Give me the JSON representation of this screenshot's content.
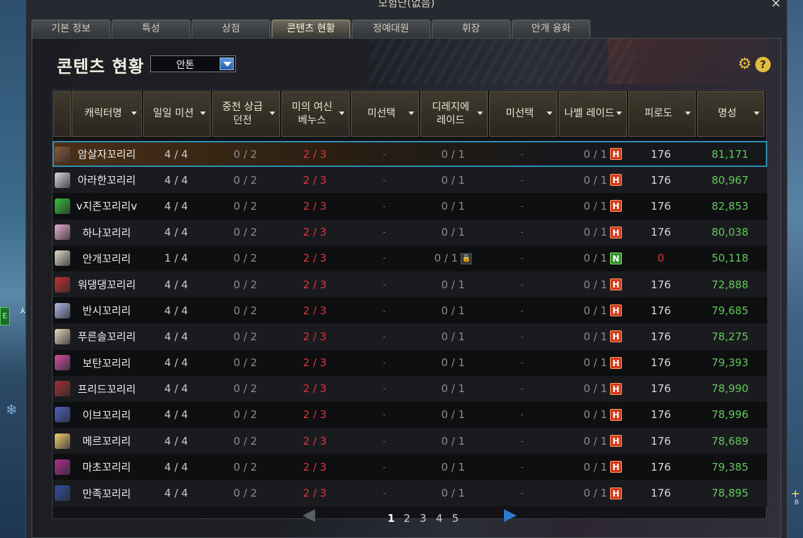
{
  "window": {
    "title": "모험단(없음)",
    "close_glyph": "×"
  },
  "tabs": [
    {
      "label": "기본 정보",
      "active": false
    },
    {
      "label": "특성",
      "active": false
    },
    {
      "label": "상점",
      "active": false
    },
    {
      "label": "콘텐츠 현황",
      "active": true
    },
    {
      "label": "정예대원",
      "active": false
    },
    {
      "label": "휘장",
      "active": false
    },
    {
      "label": "안개 융화",
      "active": false
    }
  ],
  "section": {
    "title": "콘텐츠 현황",
    "server_select": "안톤",
    "gear_icon": "gear-icon",
    "help_glyph": "?"
  },
  "columns": [
    {
      "label": "캐릭터명"
    },
    {
      "label": "일일 미션"
    },
    {
      "label": "중천 상급\n던전"
    },
    {
      "label": "미의 여신\n베누스"
    },
    {
      "label": "미선택"
    },
    {
      "label": "디레지에\n레이드"
    },
    {
      "label": "미선택"
    },
    {
      "label": "나벨 레이드"
    },
    {
      "label": "피로도"
    },
    {
      "label": "명성"
    }
  ],
  "rows": [
    {
      "name": "암살자꼬리리",
      "daily": "4 / 4",
      "dungeon": "0 / 2",
      "venus": "2 / 3",
      "empty1": "-",
      "raid": "0 / 1",
      "empty2": "-",
      "nabel": "0 / 1",
      "mode": "H",
      "fatigue": "176",
      "fame": "81,171",
      "avatar_color": "#8a5a3a",
      "selected": true
    },
    {
      "name": "아라한꼬리리",
      "daily": "4 / 4",
      "dungeon": "0 / 2",
      "venus": "2 / 3",
      "empty1": "-",
      "raid": "0 / 1",
      "empty2": "-",
      "nabel": "0 / 1",
      "mode": "H",
      "fatigue": "176",
      "fame": "80,967",
      "avatar_color": "#d8d8e0"
    },
    {
      "name": "v지존꼬리리v",
      "daily": "4 / 4",
      "dungeon": "0 / 2",
      "venus": "2 / 3",
      "empty1": "-",
      "raid": "0 / 1",
      "empty2": "-",
      "nabel": "0 / 1",
      "mode": "H",
      "fatigue": "176",
      "fame": "82,853",
      "avatar_color": "#36c036"
    },
    {
      "name": "하나꼬리리",
      "daily": "4 / 4",
      "dungeon": "0 / 2",
      "venus": "2 / 3",
      "empty1": "-",
      "raid": "0 / 1",
      "empty2": "-",
      "nabel": "0 / 1",
      "mode": "H",
      "fatigue": "176",
      "fame": "80,038",
      "avatar_color": "#e8b0d0"
    },
    {
      "name": "안개꼬리리",
      "daily": "1 / 4",
      "dungeon": "0 / 2",
      "venus": "2 / 3",
      "empty1": "-",
      "raid": "0 / 1",
      "raid_locked": true,
      "empty2": "-",
      "nabel": "0 / 1",
      "mode": "N",
      "fatigue": "0",
      "fame": "50,118",
      "avatar_color": "#e0d8c8"
    },
    {
      "name": "워댕댕꼬리리",
      "daily": "4 / 4",
      "dungeon": "0 / 2",
      "venus": "2 / 3",
      "empty1": "-",
      "raid": "0 / 1",
      "empty2": "-",
      "nabel": "0 / 1",
      "mode": "H",
      "fatigue": "176",
      "fame": "72,888",
      "avatar_color": "#c03030"
    },
    {
      "name": "반시꼬리리",
      "daily": "4 / 4",
      "dungeon": "0 / 2",
      "venus": "2 / 3",
      "empty1": "-",
      "raid": "0 / 1",
      "empty2": "-",
      "nabel": "0 / 1",
      "mode": "H",
      "fatigue": "176",
      "fame": "79,685",
      "avatar_color": "#b0b8e8"
    },
    {
      "name": "푸른솔꼬리리",
      "daily": "4 / 4",
      "dungeon": "0 / 2",
      "venus": "2 / 3",
      "empty1": "-",
      "raid": "0 / 1",
      "empty2": "-",
      "nabel": "0 / 1",
      "mode": "H",
      "fatigue": "176",
      "fame": "78,275",
      "avatar_color": "#e8d8b8"
    },
    {
      "name": "보탄꼬리리",
      "daily": "4 / 4",
      "dungeon": "0 / 2",
      "venus": "2 / 3",
      "empty1": "-",
      "raid": "0 / 1",
      "empty2": "-",
      "nabel": "0 / 1",
      "mode": "H",
      "fatigue": "176",
      "fame": "79,393",
      "avatar_color": "#d050a0"
    },
    {
      "name": "프리드꼬리리",
      "daily": "4 / 4",
      "dungeon": "0 / 2",
      "venus": "2 / 3",
      "empty1": "-",
      "raid": "0 / 1",
      "empty2": "-",
      "nabel": "0 / 1",
      "mode": "H",
      "fatigue": "176",
      "fame": "78,990",
      "avatar_color": "#a03030"
    },
    {
      "name": "이브꼬리리",
      "daily": "4 / 4",
      "dungeon": "0 / 2",
      "venus": "2 / 3",
      "empty1": "-",
      "raid": "0 / 1",
      "empty2": "-",
      "nabel": "0 / 1",
      "mode": "H",
      "fatigue": "176",
      "fame": "78,996",
      "avatar_color": "#5060c0"
    },
    {
      "name": "메르꼬리리",
      "daily": "4 / 4",
      "dungeon": "0 / 2",
      "venus": "2 / 3",
      "empty1": "-",
      "raid": "0 / 1",
      "empty2": "-",
      "nabel": "0 / 1",
      "mode": "H",
      "fatigue": "176",
      "fame": "78,689",
      "avatar_color": "#f0d070"
    },
    {
      "name": "마초꼬리리",
      "daily": "4 / 4",
      "dungeon": "0 / 2",
      "venus": "2 / 3",
      "empty1": "-",
      "raid": "0 / 1",
      "empty2": "-",
      "nabel": "0 / 1",
      "mode": "H",
      "fatigue": "176",
      "fame": "79,385",
      "avatar_color": "#b03090"
    },
    {
      "name": "만족꼬리리",
      "daily": "4 / 4",
      "dungeon": "0 / 2",
      "venus": "2 / 3",
      "empty1": "-",
      "raid": "0 / 1",
      "empty2": "-",
      "nabel": "0 / 1",
      "mode": "H",
      "fatigue": "176",
      "fame": "78,895",
      "avatar_color": "#3050a0"
    }
  ],
  "pagination": {
    "pages": [
      "1",
      "2",
      "3",
      "4",
      "5"
    ],
    "current": "1"
  },
  "background": {
    "side_text": "시",
    "side_badge": "E",
    "plus_glyph": "+",
    "b_glyph": "B",
    "snow_glyph": "❄"
  }
}
